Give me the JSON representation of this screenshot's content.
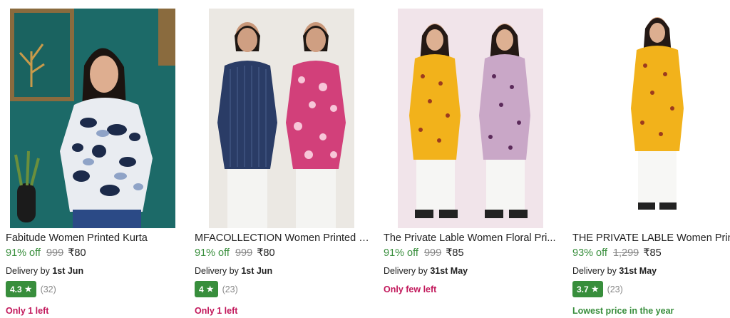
{
  "products": [
    {
      "title": "Fabitude Women Printed Kurta",
      "discount": "91% off",
      "mrp": "999",
      "price": "₹80",
      "delivery_prefix": "Delivery by",
      "delivery_date": "1st Jun",
      "rating": "4.3",
      "rating_count": "(32)",
      "note": "Only 1 left",
      "image_icon": "woman-in-printed-kurta-image"
    },
    {
      "title": "MFACOLLECTION Women Printed K...",
      "discount": "91% off",
      "mrp": "999",
      "price": "₹80",
      "delivery_prefix": "Delivery by",
      "delivery_date": "1st Jun",
      "rating": "4",
      "rating_count": "(23)",
      "note": "Only 1 left",
      "image_icon": "two-women-in-kurtas-image"
    },
    {
      "title": "The Private Lable Women Floral Pri...",
      "discount": "91% off",
      "mrp": "999",
      "price": "₹85",
      "delivery_prefix": "Delivery by",
      "delivery_date": "31st May",
      "note": "Only few left",
      "image_icon": "two-women-in-floral-kurtas-image"
    },
    {
      "title": "THE PRIVATE LABLE Women Print",
      "discount": "93% off",
      "mrp": "1,299",
      "price": "₹85",
      "delivery_prefix": "Delivery by",
      "delivery_date": "31st May",
      "rating": "3.7",
      "rating_count": "(23)",
      "note": "Lowest price in the year",
      "image_icon": "woman-in-yellow-kurta-image"
    }
  ],
  "colors": {
    "discount_green": "#388e3c",
    "rating_badge": "#388e3c",
    "urgency_red": "#c2185b",
    "mrp_gray": "#878787"
  },
  "star_glyph": "★"
}
